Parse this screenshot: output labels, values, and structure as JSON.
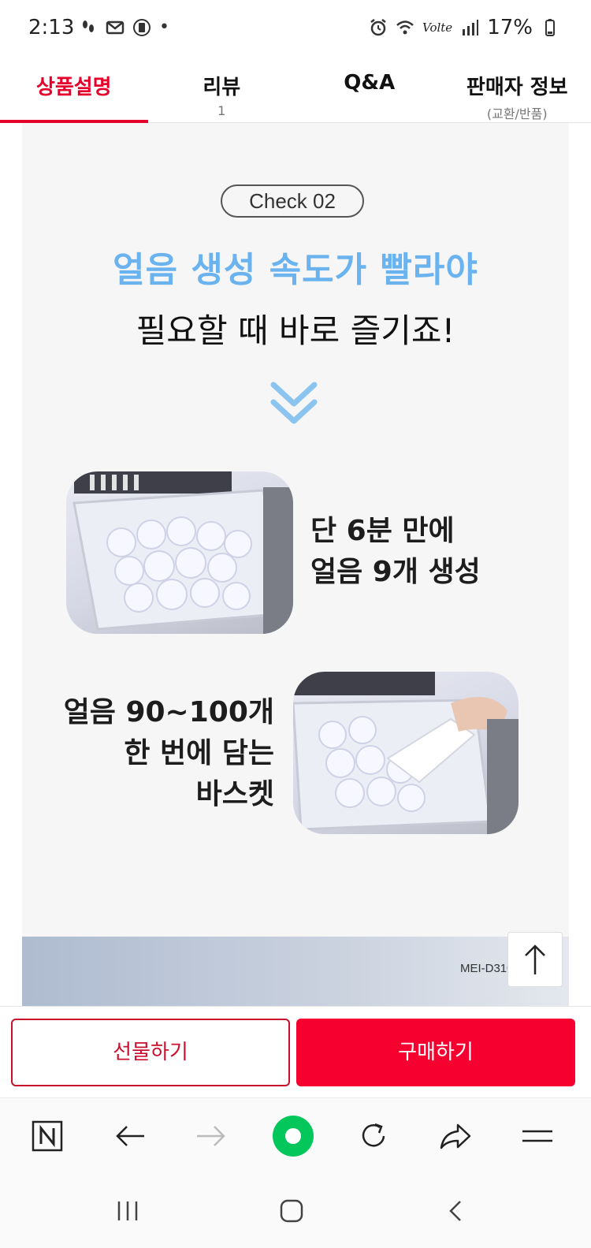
{
  "status_bar": {
    "time": "2:13",
    "dot": "•",
    "network": "Volte",
    "battery": "17%"
  },
  "tabs": [
    {
      "label": "상품설명",
      "sub": "",
      "active": true
    },
    {
      "label": "리뷰",
      "sub": "1",
      "active": false
    },
    {
      "label": "Q&A",
      "sub": "",
      "active": false
    },
    {
      "label": "판매자 정보",
      "sub": "(교환/반품)",
      "active": false
    }
  ],
  "content": {
    "check_badge": "Check 02",
    "headline_blue": "얼음 생성 속도가 빨라야",
    "headline_black": "필요할 때 바로 즐기죠!",
    "feature1": {
      "line1": "단 6분 만에",
      "line2": "얼음 9개 생성"
    },
    "feature2": {
      "line1": "얼음 90~100개",
      "line2": "한 번에 담는",
      "line3": "바스켓"
    },
    "model_label": "MEI-D3100  S"
  },
  "buttons": {
    "gift": "선물하기",
    "buy": "구매하기"
  },
  "colors": {
    "accent_red": "#e4002b",
    "buy_red": "#f5002f",
    "headline_blue": "#6ab3ee",
    "browser_green": "#03c75a"
  }
}
